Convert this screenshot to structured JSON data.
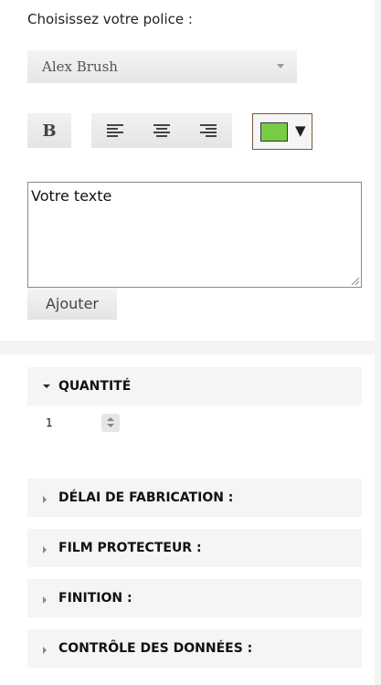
{
  "text_editor": {
    "font_label": "Choisissez votre police :",
    "font_selected": "Alex Brush",
    "bold_label": "B",
    "color_value": "#77cc44",
    "color_arrow": "▼",
    "text_value": "Votre texte",
    "add_label": "Ajouter"
  },
  "accordion": {
    "quantity": {
      "label": "QUANTITÉ",
      "value": "1"
    },
    "items": [
      {
        "label": "DÉLAI DE FABRICATION :"
      },
      {
        "label": "FILM PROTECTEUR :"
      },
      {
        "label": "FINITION :"
      },
      {
        "label": "CONTRÔLE DES DONNÉES :"
      }
    ]
  }
}
